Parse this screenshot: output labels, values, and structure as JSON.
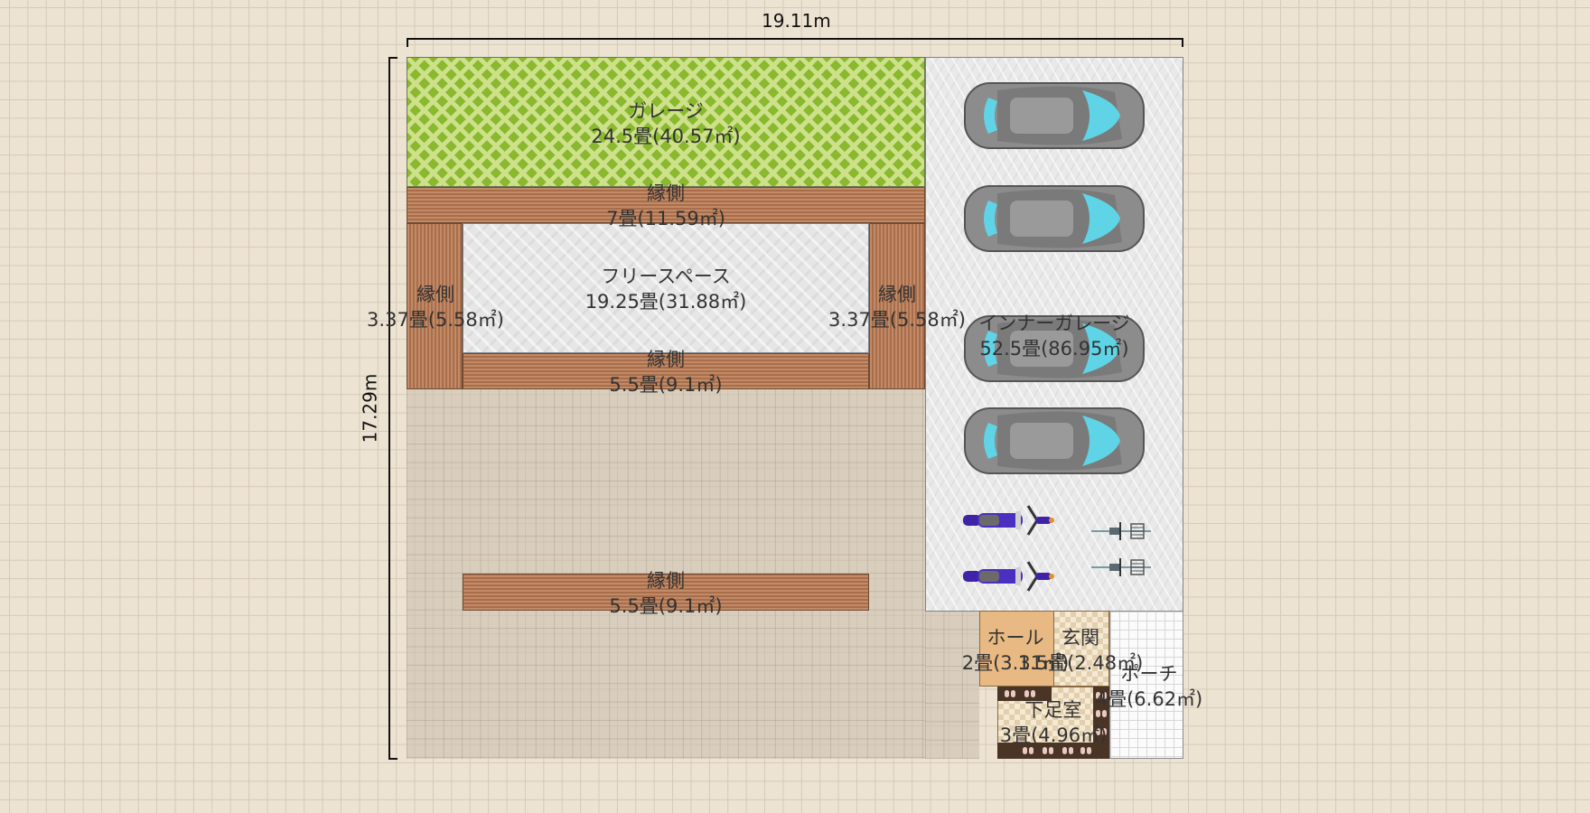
{
  "dimensions": {
    "width_label": "19.11m",
    "height_label": "17.29m"
  },
  "rooms": {
    "garage_garden": {
      "name": "ガレージ",
      "area": "24.5畳(40.57㎡)"
    },
    "engawa_top": {
      "name": "縁側",
      "area": "7畳(11.59㎡)"
    },
    "free_space": {
      "name": "フリースペース",
      "area": "19.25畳(31.88㎡)"
    },
    "engawa_left": {
      "name": "縁側",
      "area": "3.37畳(5.58㎡)"
    },
    "engawa_right": {
      "name": "縁側",
      "area": "3.37畳(5.58㎡)"
    },
    "engawa_bottom": {
      "name": "縁側",
      "area": "5.5畳(9.1㎡)"
    },
    "engawa_lower": {
      "name": "縁側",
      "area": "5.5畳(9.1㎡)"
    },
    "inner_garage": {
      "name": "インナーガレージ",
      "area": "52.5畳(86.95㎡)"
    },
    "hall": {
      "name": "ホール",
      "area": "2畳(3.31㎡)"
    },
    "entrance": {
      "name": "玄関",
      "area": "1.5畳(2.48㎡)"
    },
    "porch": {
      "name": "ポーチ",
      "area": "4畳(6.62㎡)"
    },
    "shoe_room": {
      "name": "下足室",
      "area": "3畳(4.96㎡)"
    }
  },
  "vehicles": {
    "cars": 4,
    "motorcycles": 2,
    "bicycles": 2
  },
  "colors": {
    "grass": "#8ab82e",
    "wood": "#b77c57",
    "car_body": "#8c8c8c",
    "car_glass": "#5fd4e6",
    "motorcycle": "#3f22a8"
  }
}
